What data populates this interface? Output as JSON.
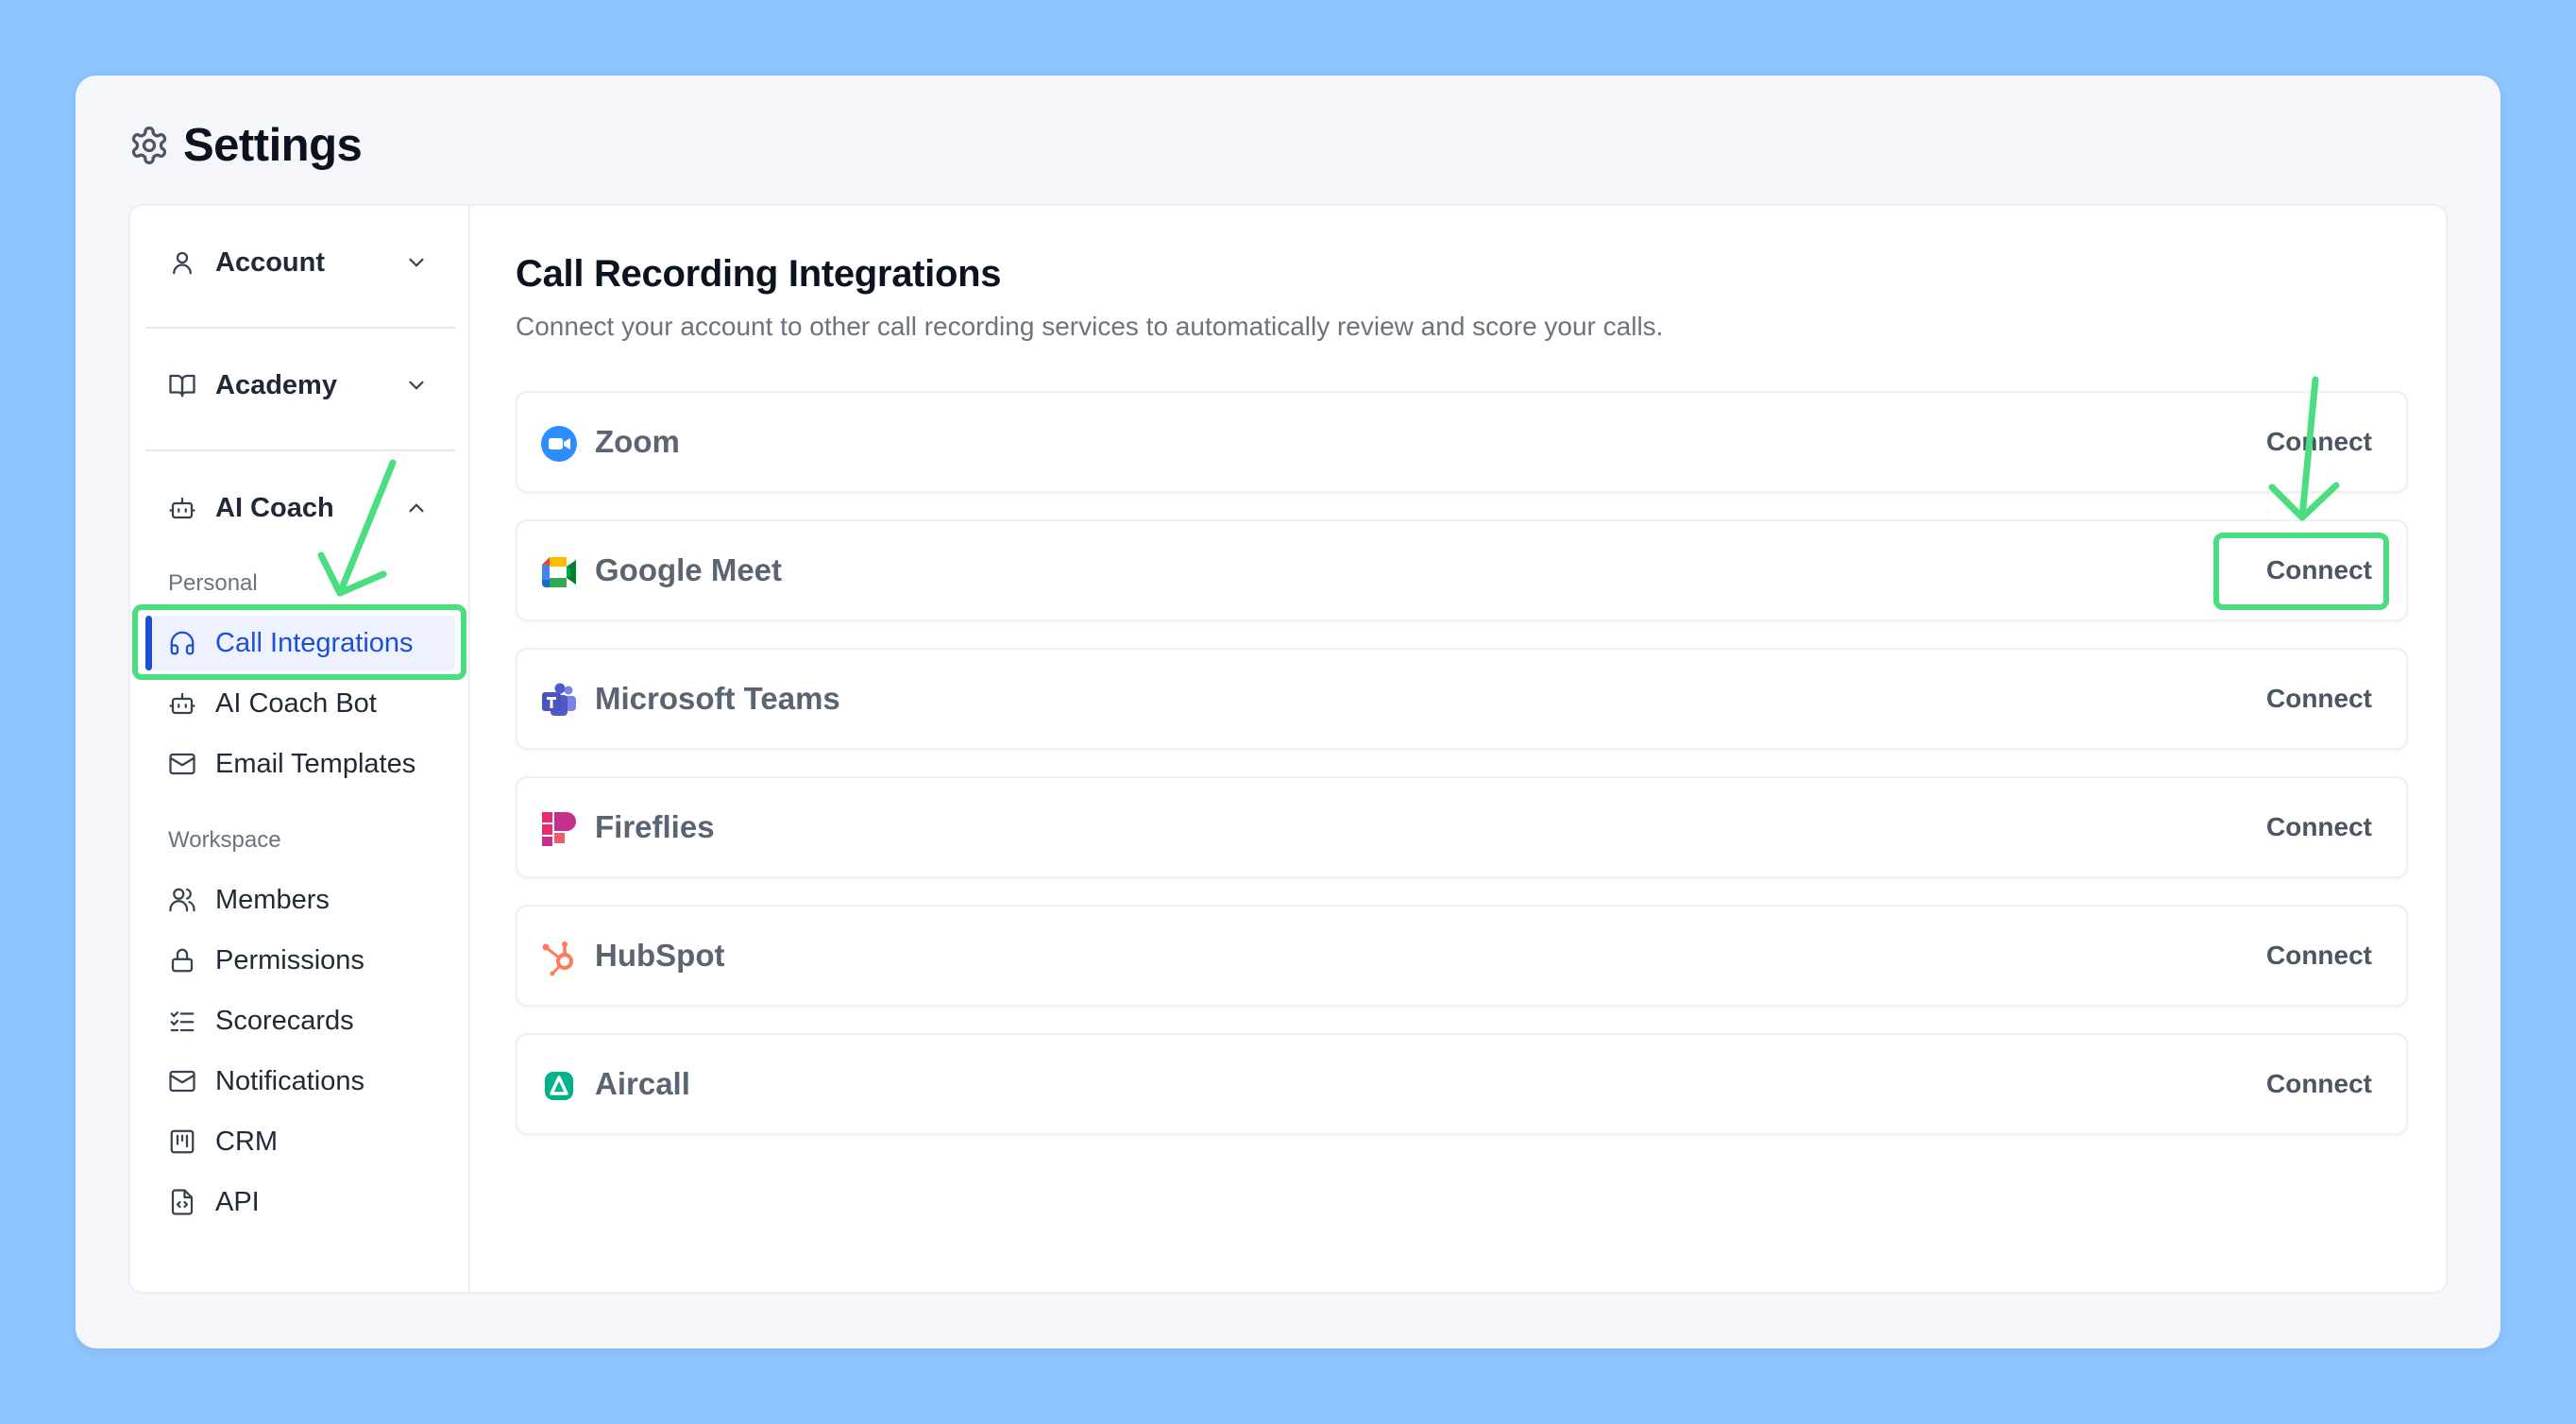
{
  "page": {
    "title": "Settings"
  },
  "sidebar": {
    "groups": [
      {
        "label": "Account",
        "icon": "user-icon",
        "chevron": "chevron-down-icon"
      },
      {
        "label": "Academy",
        "icon": "book-icon",
        "chevron": "chevron-down-icon"
      },
      {
        "label": "AI Coach",
        "icon": "bot-icon",
        "chevron": "chevron-up-icon"
      }
    ],
    "sections": {
      "personal": "Personal",
      "workspace": "Workspace"
    },
    "personal_items": [
      {
        "label": "Call Integrations",
        "icon": "headset-icon",
        "active": true
      },
      {
        "label": "AI Coach Bot",
        "icon": "bot-icon"
      },
      {
        "label": "Email Templates",
        "icon": "mail-icon"
      }
    ],
    "workspace_items": [
      {
        "label": "Members",
        "icon": "users-icon"
      },
      {
        "label": "Permissions",
        "icon": "lock-icon"
      },
      {
        "label": "Scorecards",
        "icon": "checklist-icon"
      },
      {
        "label": "Notifications",
        "icon": "mail-icon"
      },
      {
        "label": "CRM",
        "icon": "kanban-icon"
      },
      {
        "label": "API",
        "icon": "file-code-icon"
      }
    ]
  },
  "main": {
    "title": "Call Recording Integrations",
    "subtitle": "Connect your account to other call recording services to automatically review and score your calls.",
    "integrations": [
      {
        "name": "Zoom",
        "icon": "zoom-logo",
        "action": "Connect"
      },
      {
        "name": "Google Meet",
        "icon": "google-meet-logo",
        "action": "Connect"
      },
      {
        "name": "Microsoft Teams",
        "icon": "microsoft-teams-logo",
        "action": "Connect"
      },
      {
        "name": "Fireflies",
        "icon": "fireflies-logo",
        "action": "Connect"
      },
      {
        "name": "HubSpot",
        "icon": "hubspot-logo",
        "action": "Connect"
      },
      {
        "name": "Aircall",
        "icon": "aircall-logo",
        "action": "Connect"
      }
    ]
  },
  "colors": {
    "background": "#8ec5ff",
    "accent": "#1d4ed8",
    "annotation": "#4ade80"
  }
}
